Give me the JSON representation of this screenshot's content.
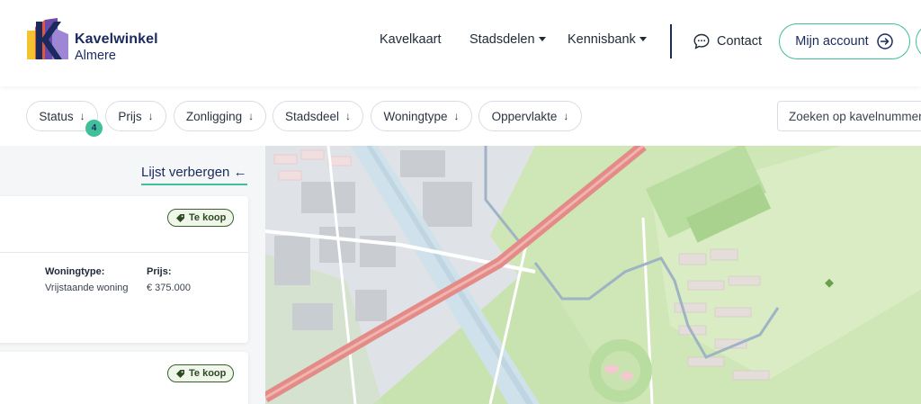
{
  "brand": {
    "title": "Kavelwinkel",
    "subtitle": "Almere"
  },
  "nav": {
    "items": [
      {
        "label": "Kavelkaart",
        "dropdown": false
      },
      {
        "label": "Stadsdelen",
        "dropdown": true
      },
      {
        "label": "Kennisbank",
        "dropdown": true
      }
    ],
    "contact_label": "Contact",
    "account_label": "Mijn account"
  },
  "filters": {
    "chips": [
      {
        "label": "Status"
      },
      {
        "label": "Prijs"
      },
      {
        "label": "Zonligging"
      },
      {
        "label": "Stadsdeel"
      },
      {
        "label": "Woningtype"
      },
      {
        "label": "Oppervlakte"
      }
    ],
    "status_count": "4",
    "search_placeholder": "Zoeken op kavelnummer"
  },
  "list": {
    "toggle_label": "Lijst verbergen",
    "cards": [
      {
        "status": "Te koop",
        "woningtype_label": "Woningtype:",
        "woningtype": "Vrijstaande woning",
        "prijs_label": "Prijs:",
        "prijs": "€ 375.000"
      },
      {
        "status": "Te koop"
      }
    ]
  },
  "colors": {
    "accent": "#3fbf9a",
    "brand_navy": "#1b2a5e",
    "map_green": "#c9e3b0",
    "map_highway": "#e38b87",
    "map_water": "#cfe1ea"
  }
}
